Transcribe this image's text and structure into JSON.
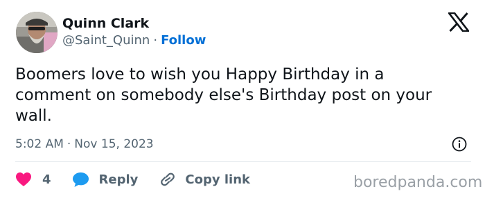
{
  "author": {
    "name": "Quinn Clark",
    "handle": "@Saint_Quinn",
    "separator": "·",
    "follow_label": "Follow"
  },
  "tweet": {
    "text": "Boomers love to wish you Happy Birthday in a comment on somebody else's Birthday post on your wall.",
    "time": "5:02 AM",
    "separator": "·",
    "date": "Nov 15, 2023"
  },
  "actions": {
    "like_count": "4",
    "reply_label": "Reply",
    "copy_label": "Copy link"
  },
  "watermark": "boredpanda.com",
  "colors": {
    "follow": "#006fd6",
    "heart": "#f91880",
    "reply_bubble": "#1d9bf0",
    "secondary_text": "#536471"
  },
  "icons": {
    "brand": "x-logo-icon",
    "info": "info-icon",
    "like": "heart-icon",
    "reply": "speech-bubble-icon",
    "copy": "link-icon"
  }
}
